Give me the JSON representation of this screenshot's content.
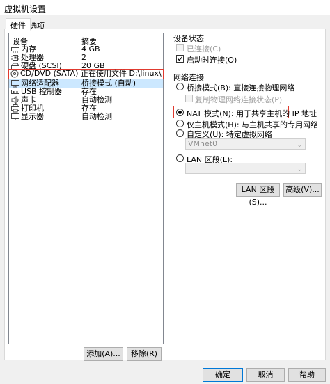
{
  "window": {
    "title": "虚拟机设置"
  },
  "tabs": [
    {
      "label": "硬件"
    },
    {
      "label": "选项"
    }
  ],
  "device_list": {
    "columns": [
      "设备",
      "摘要"
    ],
    "rows": [
      {
        "icon": "memory-icon",
        "device": "内存",
        "summary": "4 GB"
      },
      {
        "icon": "cpu-icon",
        "device": "处理器",
        "summary": "2"
      },
      {
        "icon": "harddisk-icon",
        "device": "硬盘 (SCSI)",
        "summary": "20 GB"
      },
      {
        "icon": "cdrom-icon",
        "device": "CD/DVD (SATA)",
        "summary": "正在使用文件 D:\\linux\\CenoS..."
      },
      {
        "icon": "network-icon",
        "device": "网络适配器",
        "summary": "桥接模式 (自动)"
      },
      {
        "icon": "usb-icon",
        "device": "USB 控制器",
        "summary": "存在"
      },
      {
        "icon": "sound-icon",
        "device": "声卡",
        "summary": "自动检测"
      },
      {
        "icon": "printer-icon",
        "device": "打印机",
        "summary": "存在"
      },
      {
        "icon": "display-icon",
        "device": "显示器",
        "summary": "自动检测"
      }
    ],
    "selected_index": 4
  },
  "list_buttons": {
    "add": "添加(A)...",
    "remove": "移除(R)"
  },
  "device_status": {
    "title": "设备状态",
    "connected_label": "已连接(C)",
    "connected_checked": false,
    "connected_disabled": true,
    "connect_at_power_on_label": "启动时连接(O)",
    "connect_at_power_on_checked": true
  },
  "network_connection": {
    "title": "网络连接",
    "bridged_label": "桥接模式(B): 直接连接物理网络",
    "replicate_label": "复制物理网络连接状态(P)",
    "nat_label": "NAT 模式(N): 用于共享主机的 IP 地址",
    "hostonly_label": "仅主机模式(H): 与主机共享的专用网络",
    "custom_label": "自定义(U): 特定虚拟网络",
    "custom_select_value": "VMnet0",
    "lan_label": "LAN 区段(L):",
    "lan_select_value": "",
    "selected": "nat"
  },
  "right_buttons": {
    "lan_segments": "LAN 区段(S)...",
    "advanced": "高级(V)..."
  },
  "footer_buttons": {
    "ok": "确定",
    "cancel": "取消",
    "help": "帮助"
  },
  "colors": {
    "highlight_box": "#e03a2f",
    "selection": "#cce8ff",
    "accent": "#0078d7"
  }
}
